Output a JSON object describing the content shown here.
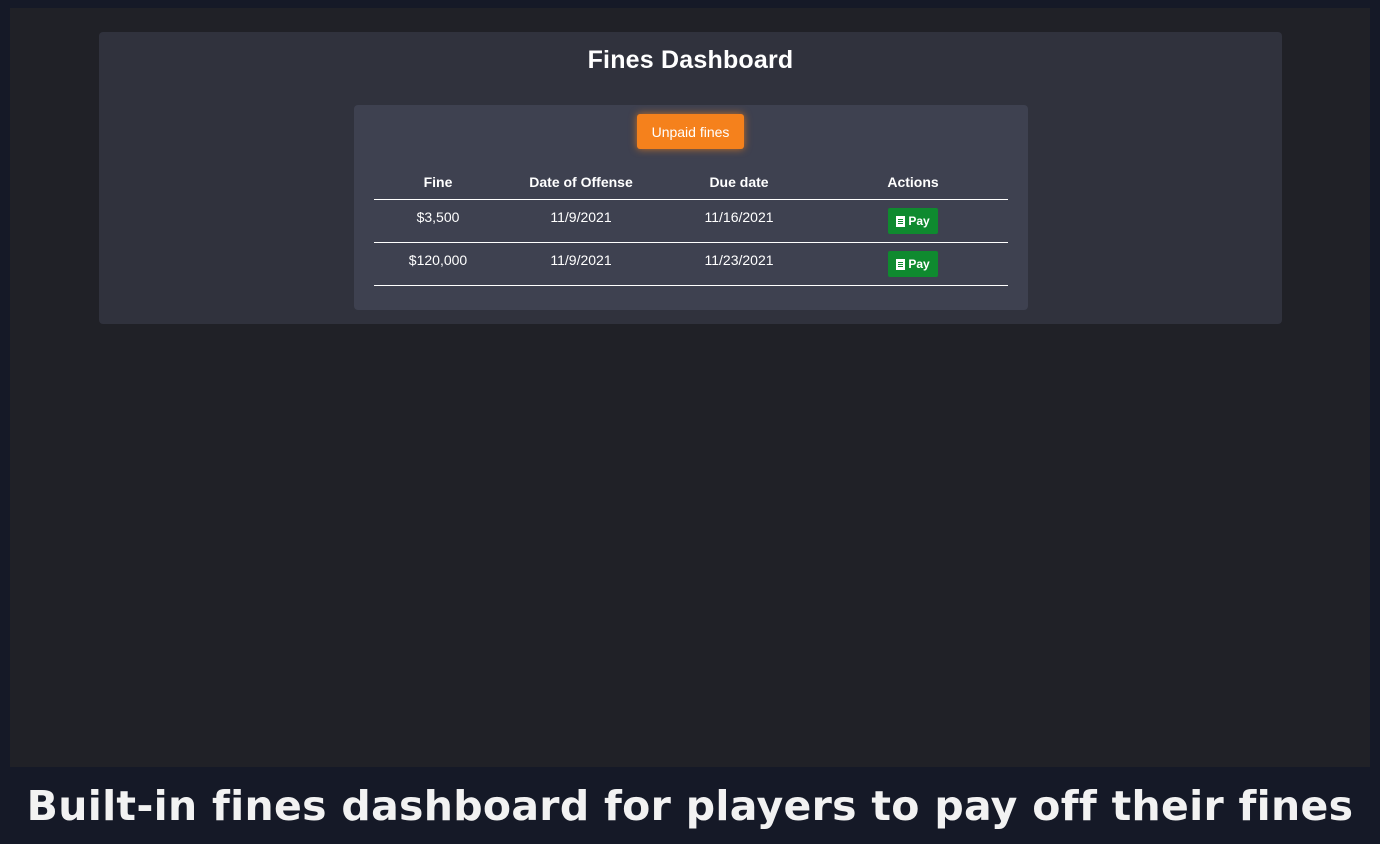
{
  "header": {
    "title": "Fines Dashboard"
  },
  "filter": {
    "tab_label": "Unpaid fines",
    "accent_color": "#f5811c"
  },
  "table": {
    "columns": [
      "Fine",
      "Date of Offense",
      "Due date",
      "Actions"
    ],
    "rows": [
      {
        "fine": "$3,500",
        "date_of_offense": "11/9/2021",
        "due_date": "11/16/2021",
        "action_label": "Pay",
        "action_icon": "receipt-icon"
      },
      {
        "fine": "$120,000",
        "date_of_offense": "11/9/2021",
        "due_date": "11/23/2021",
        "action_label": "Pay",
        "action_icon": "receipt-icon"
      }
    ],
    "pay_color": "#0f8a2f"
  },
  "caption": {
    "text": "Built-in fines dashboard for players to pay off their fines"
  }
}
